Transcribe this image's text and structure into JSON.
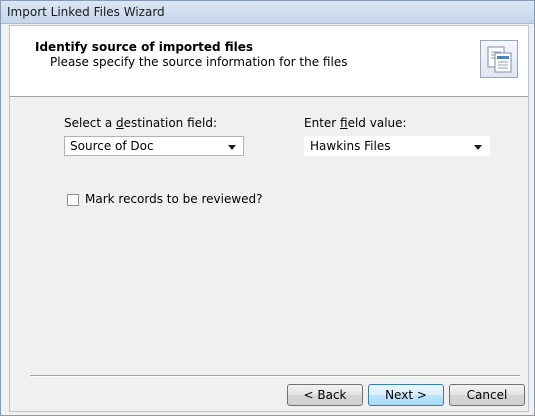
{
  "window": {
    "title": "Import Linked Files Wizard"
  },
  "header": {
    "title": "Identify source of imported files",
    "subtitle": "Please specify the source information for the files",
    "icon": "documents-icon"
  },
  "destination": {
    "label_prefix": "Select a ",
    "label_accel": "d",
    "label_suffix": "estination field:",
    "value": "Source of Doc"
  },
  "field_value": {
    "label_prefix": "Enter ",
    "label_accel": "f",
    "label_suffix": "ield value:",
    "value": "Hawkins Files"
  },
  "review_checkbox": {
    "label": "Mark records to be reviewed?",
    "checked": false
  },
  "buttons": {
    "back": "< Back",
    "next": "Next >",
    "cancel": "Cancel"
  },
  "colors": {
    "accent": "#3c7fb1",
    "titlebar": "#c5d6ea",
    "background": "#f0f0f0"
  }
}
